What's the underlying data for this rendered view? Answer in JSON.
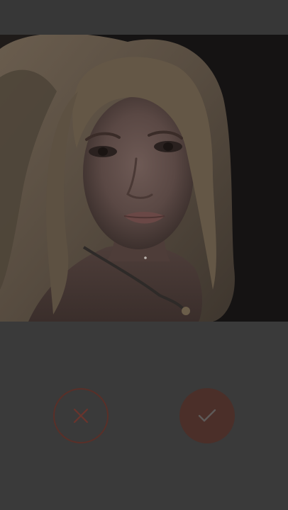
{
  "app": {
    "screen": "photo-crop-review"
  },
  "colors": {
    "background": "#3a3a3a",
    "top_bar": "#373737",
    "cancel_ring": "#5a2f28",
    "confirm_fill": "#4b2f29",
    "icon_stroke": "#5e5a58"
  },
  "photo": {
    "subject": "portrait-photo",
    "tint": "dimmed-overlay"
  },
  "actions": {
    "cancel_icon": "close-icon",
    "confirm_icon": "check-icon"
  }
}
